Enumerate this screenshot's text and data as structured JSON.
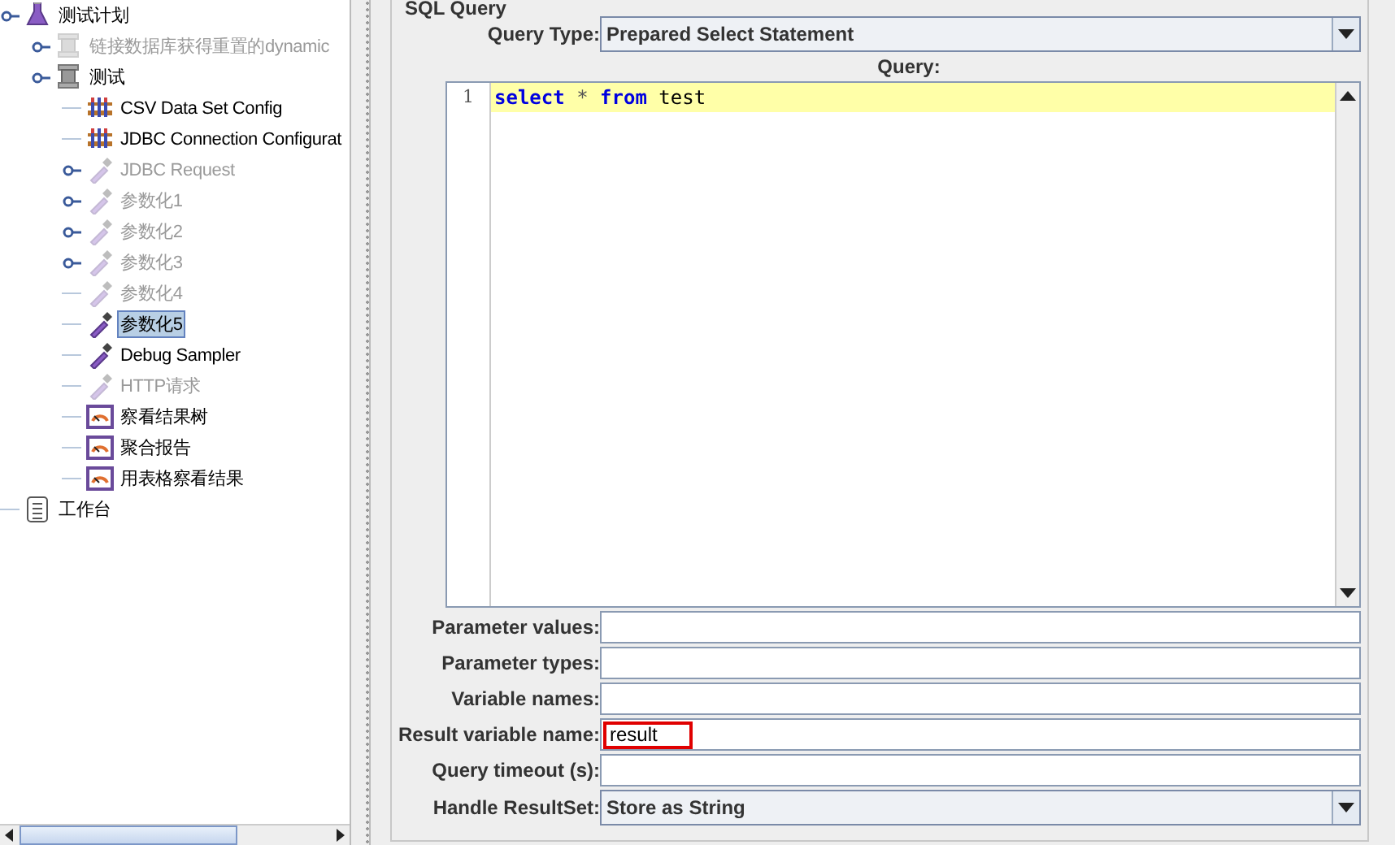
{
  "tree": [
    {
      "label": "测试计划",
      "kind": "plan",
      "handle": true,
      "disabled": false,
      "selected": false,
      "children": [
        {
          "label": "链接数据库获得重置的dynamic",
          "kind": "thread-group",
          "handle": true,
          "disabled": true,
          "selected": false
        },
        {
          "label": "测试",
          "kind": "thread-group",
          "handle": true,
          "disabled": false,
          "selected": false,
          "children": [
            {
              "label": "CSV Data Set Config",
              "kind": "config",
              "handle": false,
              "disabled": false,
              "selected": false
            },
            {
              "label": "JDBC Connection Configurat",
              "kind": "config",
              "handle": false,
              "disabled": false,
              "selected": false
            },
            {
              "label": "JDBC Request",
              "kind": "sampler",
              "handle": true,
              "disabled": true,
              "selected": false
            },
            {
              "label": "参数化1",
              "kind": "sampler",
              "handle": true,
              "disabled": true,
              "selected": false
            },
            {
              "label": "参数化2",
              "kind": "sampler",
              "handle": true,
              "disabled": true,
              "selected": false
            },
            {
              "label": "参数化3",
              "kind": "sampler",
              "handle": true,
              "disabled": true,
              "selected": false
            },
            {
              "label": "参数化4",
              "kind": "sampler",
              "handle": false,
              "disabled": true,
              "selected": false
            },
            {
              "label": "参数化5",
              "kind": "sampler",
              "handle": false,
              "disabled": false,
              "selected": true
            },
            {
              "label": "Debug Sampler",
              "kind": "sampler",
              "handle": false,
              "disabled": false,
              "selected": false
            },
            {
              "label": "HTTP请求",
              "kind": "sampler",
              "handle": false,
              "disabled": true,
              "selected": false
            },
            {
              "label": "察看结果树",
              "kind": "listener",
              "handle": false,
              "disabled": false,
              "selected": false
            },
            {
              "label": "聚合报告",
              "kind": "listener",
              "handle": false,
              "disabled": false,
              "selected": false
            },
            {
              "label": "用表格察看结果",
              "kind": "listener",
              "handle": false,
              "disabled": false,
              "selected": false
            }
          ]
        }
      ]
    },
    {
      "label": "工作台",
      "kind": "workbench",
      "handle": false,
      "disabled": false,
      "selected": false
    }
  ],
  "section_title": "SQL Query",
  "query_type": {
    "label": "Query Type:",
    "value": "Prepared Select Statement"
  },
  "query": {
    "label": "Query:",
    "line_number": "1",
    "tokens": [
      {
        "text": "select",
        "kind": "keyword"
      },
      {
        "text": " * ",
        "kind": "operator"
      },
      {
        "text": "from",
        "kind": "keyword"
      },
      {
        "text": " test",
        "kind": "plain"
      }
    ]
  },
  "fields": [
    {
      "label": "Parameter values:",
      "highlighted": false
    },
    {
      "label": "Parameter types:",
      "highlighted": false
    },
    {
      "label": "Variable names:",
      "highlighted": false
    },
    {
      "label": "Result variable name:",
      "value": "result",
      "highlighted": true
    },
    {
      "label": "Query timeout (s):",
      "highlighted": false
    }
  ],
  "handle_resultset": {
    "label": "Handle ResultSet:",
    "value": "Store as String"
  }
}
